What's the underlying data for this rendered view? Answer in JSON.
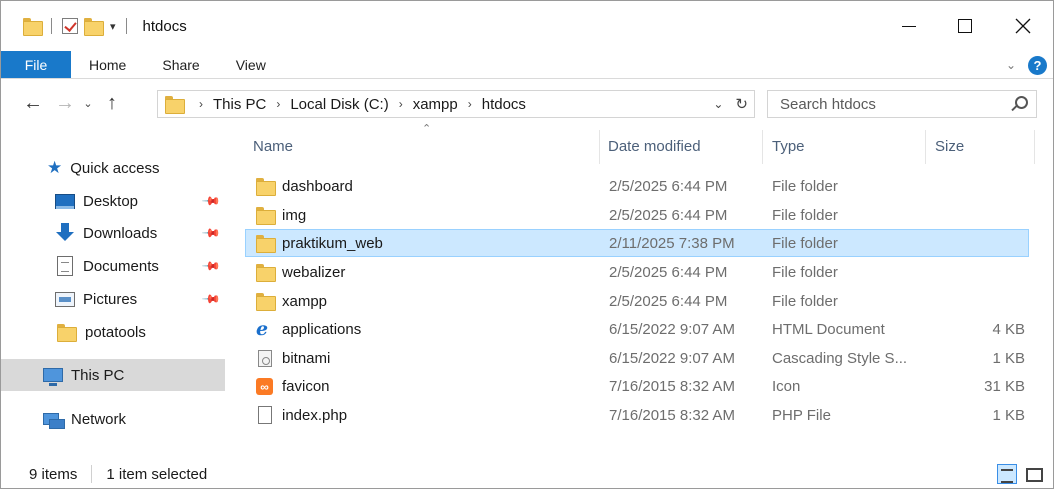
{
  "window": {
    "title": "htdocs",
    "qat_dropdown": "▾"
  },
  "ribbon": {
    "file_tab": "File",
    "tabs": [
      "Home",
      "Share",
      "View"
    ]
  },
  "address": {
    "crumbs": [
      "This PC",
      "Local Disk (C:)",
      "xampp",
      "htdocs"
    ],
    "separator": "›"
  },
  "search": {
    "placeholder": "Search htdocs"
  },
  "nav_pane": {
    "items": [
      {
        "label": "Quick access",
        "icon": "star-icon",
        "pinned": false
      },
      {
        "label": "Desktop",
        "icon": "desktop-icon",
        "pinned": true
      },
      {
        "label": "Downloads",
        "icon": "downloads-icon",
        "pinned": true
      },
      {
        "label": "Documents",
        "icon": "documents-icon",
        "pinned": true
      },
      {
        "label": "Pictures",
        "icon": "pictures-icon",
        "pinned": true
      },
      {
        "label": "potatools",
        "icon": "folder-icon",
        "pinned": false
      },
      {
        "label": "This PC",
        "icon": "this-pc-icon",
        "pinned": false,
        "selected": true
      },
      {
        "label": "Network",
        "icon": "network-icon",
        "pinned": false
      }
    ]
  },
  "columns": {
    "name": "Name",
    "date": "Date modified",
    "type": "Type",
    "size": "Size"
  },
  "files": [
    {
      "name": "dashboard",
      "date": "2/5/2025 6:44 PM",
      "type": "File folder",
      "size": "",
      "icon": "folder-icon"
    },
    {
      "name": "img",
      "date": "2/5/2025 6:44 PM",
      "type": "File folder",
      "size": "",
      "icon": "folder-icon"
    },
    {
      "name": "praktikum_web",
      "date": "2/11/2025 7:38 PM",
      "type": "File folder",
      "size": "",
      "icon": "folder-icon",
      "selected": true
    },
    {
      "name": "webalizer",
      "date": "2/5/2025 6:44 PM",
      "type": "File folder",
      "size": "",
      "icon": "folder-icon"
    },
    {
      "name": "xampp",
      "date": "2/5/2025 6:44 PM",
      "type": "File folder",
      "size": "",
      "icon": "folder-icon"
    },
    {
      "name": "applications",
      "date": "6/15/2022 9:07 AM",
      "type": "HTML Document",
      "size": "4 KB",
      "icon": "html-document-icon"
    },
    {
      "name": "bitnami",
      "date": "6/15/2022 9:07 AM",
      "type": "Cascading Style S...",
      "size": "1 KB",
      "icon": "css-file-icon"
    },
    {
      "name": "favicon",
      "date": "7/16/2015 8:32 AM",
      "type": "Icon",
      "size": "31 KB",
      "icon": "xampp-icon"
    },
    {
      "name": "index.php",
      "date": "7/16/2015 8:32 AM",
      "type": "PHP File",
      "size": "1 KB",
      "icon": "php-file-icon"
    }
  ],
  "status": {
    "item_count": "9 items",
    "selection": "1 item selected"
  },
  "colors": {
    "accent": "#1979ca",
    "selection_bg": "#cce8ff",
    "selection_border": "#99d1ff",
    "nav_selected_bg": "#d9d9d9",
    "folder": "#f8d26a"
  }
}
